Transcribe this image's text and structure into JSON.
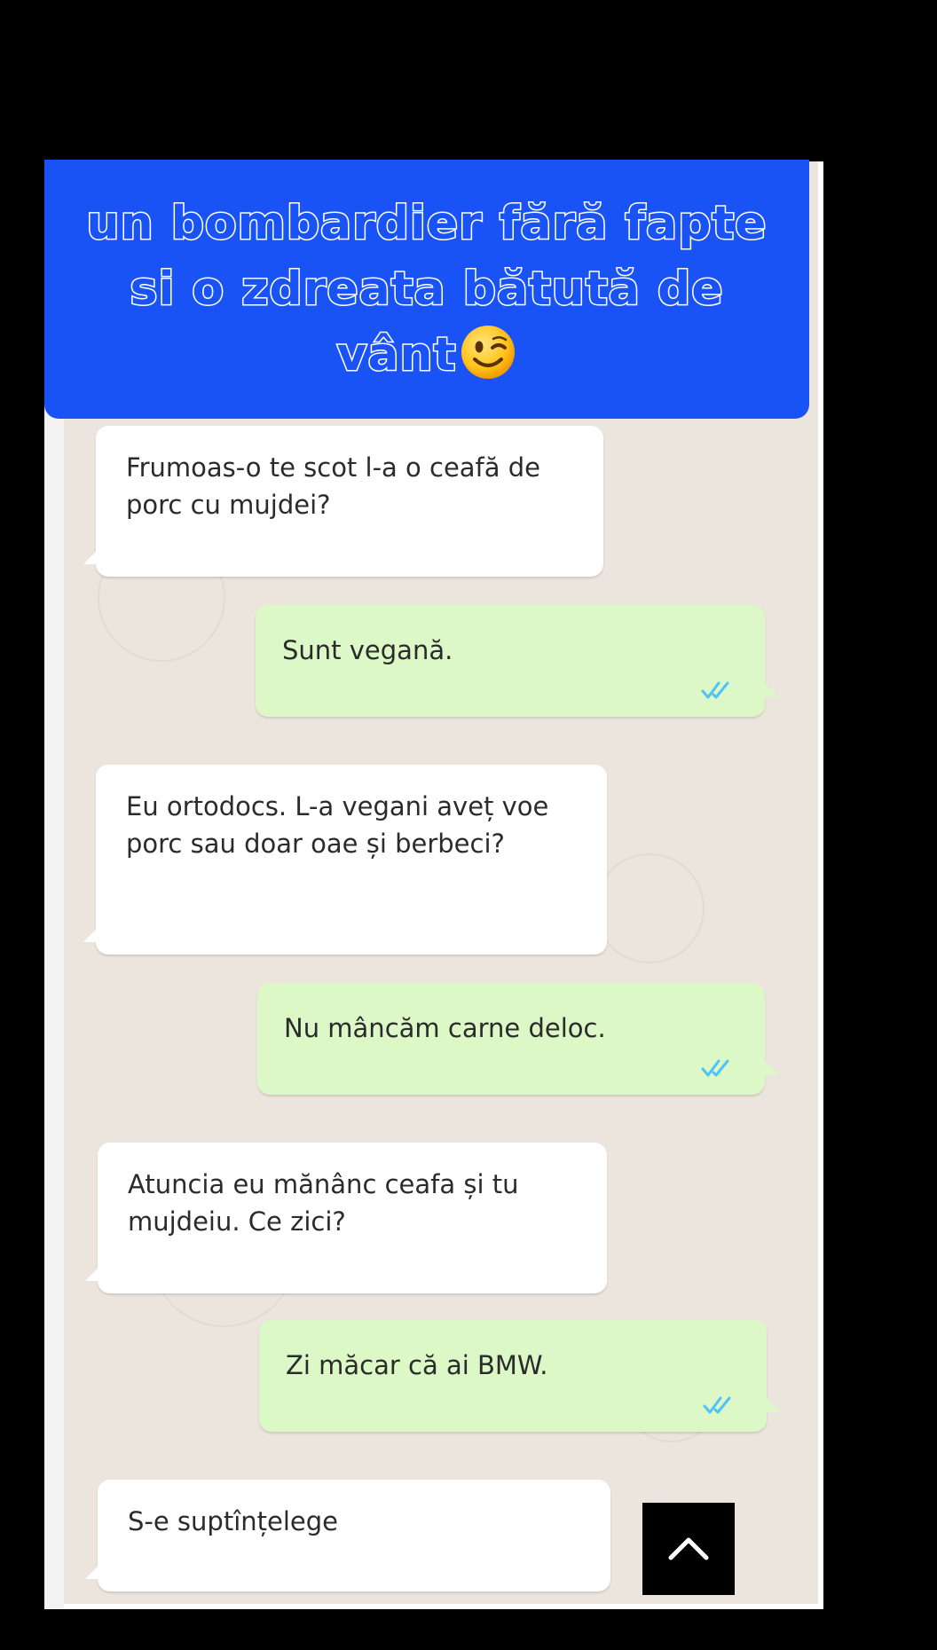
{
  "caption": {
    "text": "un bombardier fără fapte si o zdreata bătută de vânt",
    "emoji": "winking-face-emoji"
  },
  "messages": [
    {
      "direction": "incoming",
      "text": "Frumoas-o te scot l-a o ceafă de porc cu mujdei?"
    },
    {
      "direction": "outgoing",
      "text": "Sunt vegană.",
      "status": "read"
    },
    {
      "direction": "incoming",
      "text": "Eu ortodocs. L-a vegani aveț voe porc sau doar oae și berbeci?"
    },
    {
      "direction": "outgoing",
      "text": "Nu mâncăm carne deloc.",
      "status": "read"
    },
    {
      "direction": "incoming",
      "text": "Atuncia eu mănânc ceafa și tu mujdeiu. Ce zici?"
    },
    {
      "direction": "outgoing",
      "text": "Zi măcar că ai BMW.",
      "status": "read"
    },
    {
      "direction": "incoming",
      "text": "S-e suptînțelege"
    }
  ],
  "colors": {
    "banner": "#1a53f5",
    "chat_background": "#ece5dd",
    "incoming_bubble": "#ffffff",
    "outgoing_bubble": "#dcf8c6",
    "read_ticks": "#4fc3f7"
  },
  "icons": {
    "read_receipt": "double-check-icon",
    "scroll_top": "chevron-up-icon"
  }
}
